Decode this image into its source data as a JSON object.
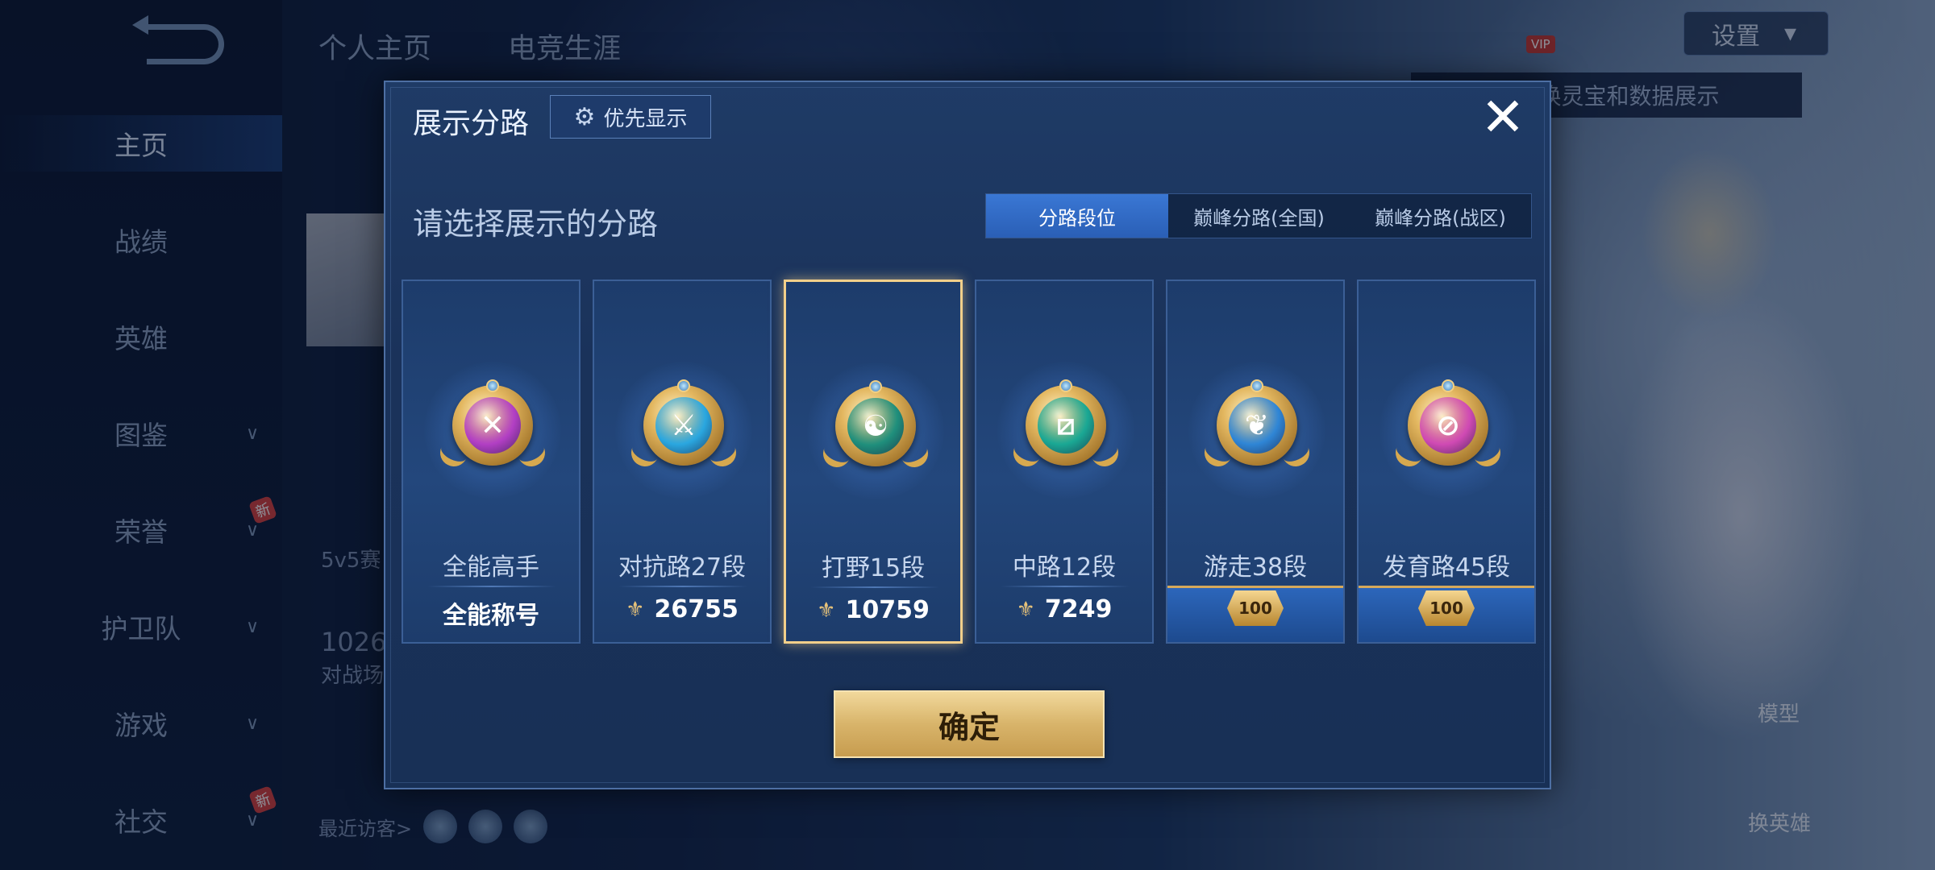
{
  "background": {
    "top_tabs": [
      "个人主页",
      "电竞生涯"
    ],
    "nav": [
      {
        "label": "主页",
        "active": true,
        "chevron": false,
        "new": false
      },
      {
        "label": "战绩",
        "active": false,
        "chevron": false,
        "new": false
      },
      {
        "label": "英雄",
        "active": false,
        "chevron": false,
        "new": false
      },
      {
        "label": "图鉴",
        "active": false,
        "chevron": true,
        "new": false
      },
      {
        "label": "荣誉",
        "active": false,
        "chevron": true,
        "new": true
      },
      {
        "label": "护卫队",
        "active": false,
        "chevron": true,
        "new": false
      },
      {
        "label": "游戏",
        "active": false,
        "chevron": true,
        "new": false
      },
      {
        "label": "社交",
        "active": false,
        "chevron": true,
        "new": true
      }
    ],
    "new_badge": "新",
    "settings_label": "设置",
    "vip_label": "VIP",
    "tip_text": "以切换灵宝和数据展示",
    "recent_visitors_label": "最近访客>",
    "partial_texts": {
      "match_label": "5v5赛",
      "number": "1026",
      "battle_label": "对战场"
    },
    "right_buttons": {
      "model": "模型",
      "change_hero": "换英雄"
    }
  },
  "modal": {
    "title": "展示分路",
    "priority_button": "优先显示",
    "subtitle": "请选择展示的分路",
    "segments": [
      {
        "label": "分路段位",
        "active": true
      },
      {
        "label": "巅峰分路(全国)",
        "active": false
      },
      {
        "label": "巅峰分路(战区)",
        "active": false
      }
    ],
    "cards": [
      {
        "name": "全能高手",
        "stat": "全能称号",
        "power": false,
        "peak": false,
        "color": "#b23fc4",
        "icon": "crossed-slashes-icon",
        "glyph": "✕",
        "selected": false
      },
      {
        "name": "对抗路27段",
        "stat": "26755",
        "power": true,
        "peak": false,
        "color": "#2aa7e0",
        "icon": "sword-shield-icon",
        "glyph": "⚔",
        "selected": false
      },
      {
        "name": "打野15段",
        "stat": "10759",
        "power": true,
        "peak": false,
        "color": "#1f8f7c",
        "icon": "dragon-icon",
        "glyph": "☯",
        "selected": true
      },
      {
        "name": "中路12段",
        "stat": "7249",
        "power": true,
        "peak": false,
        "color": "#1aa894",
        "icon": "diagonal-slash-icon",
        "glyph": "⧄",
        "selected": false
      },
      {
        "name": "游走38段",
        "stat": "100",
        "power": false,
        "peak": true,
        "color": "#2f86d6",
        "icon": "wings-icon",
        "glyph": "❦",
        "selected": false
      },
      {
        "name": "发育路45段",
        "stat": "100",
        "power": false,
        "peak": true,
        "color": "#d04ab4",
        "icon": "no-sign-icon",
        "glyph": "⊘",
        "selected": false
      }
    ],
    "confirm_label": "确定"
  }
}
